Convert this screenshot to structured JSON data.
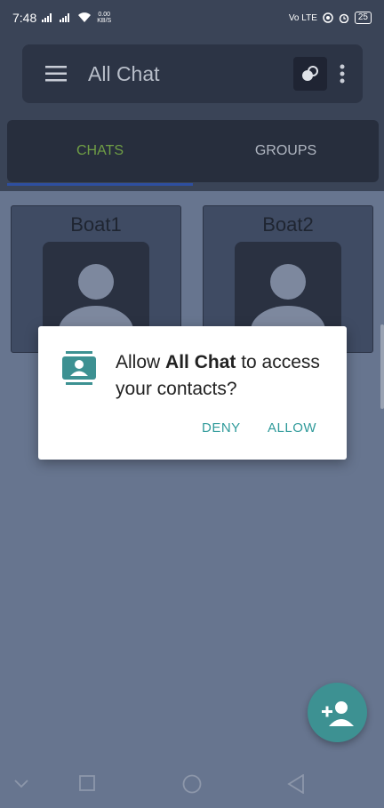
{
  "status_bar": {
    "time": "7:48",
    "speed_top": "0.00",
    "speed_bottom": "KB/S",
    "network_label": "Vo LTE",
    "battery": "25"
  },
  "app_bar": {
    "title": "All Chat"
  },
  "tabs": [
    {
      "label": "CHATS",
      "selected": true
    },
    {
      "label": "GROUPS",
      "selected": false
    }
  ],
  "contacts": [
    {
      "name": "Boat1"
    },
    {
      "name": "Boat2"
    }
  ],
  "dialog": {
    "prefix": "Allow ",
    "app_name": "All Chat",
    "suffix": " to access your contacts?",
    "deny_label": "DENY",
    "allow_label": "ALLOW"
  },
  "colors": {
    "accent_teal": "#3d9192",
    "tab_selected": "#6f9e45",
    "tab_indicator": "#2e4fa0"
  },
  "icons": {
    "menu": "hamburger-icon",
    "more": "more-vert-icon",
    "dialog": "contacts-icon",
    "fab": "add-person-icon"
  }
}
